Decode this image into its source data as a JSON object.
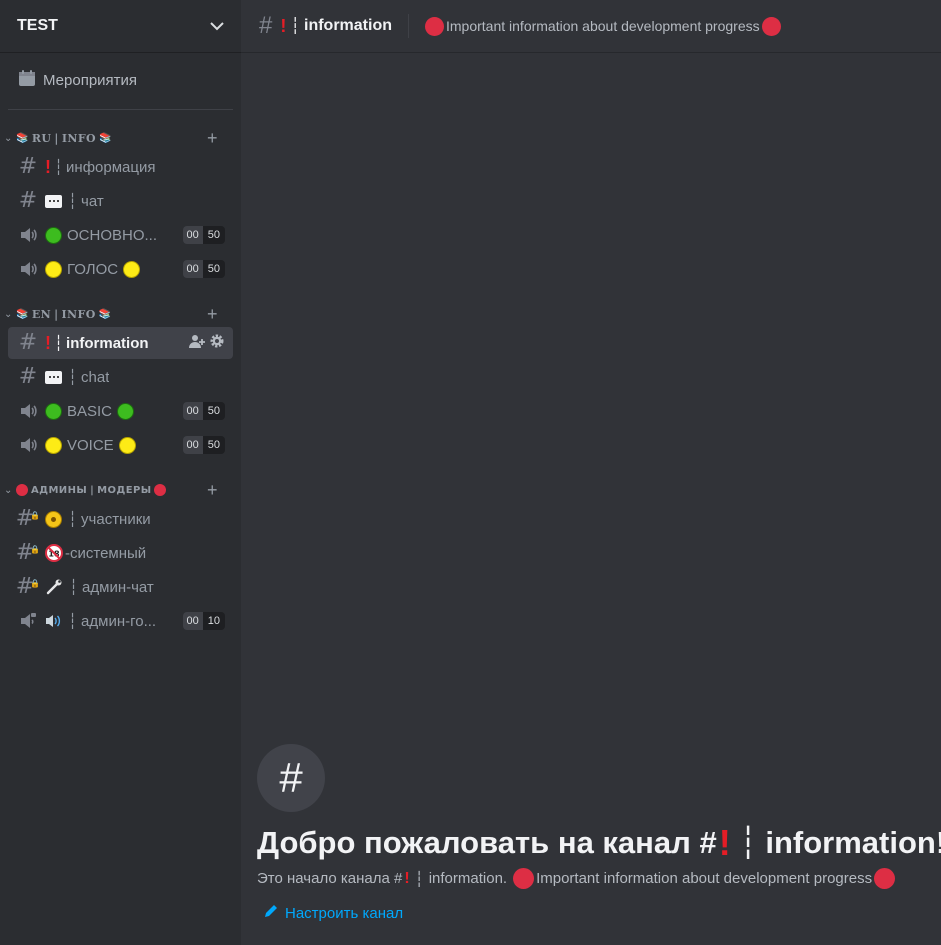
{
  "server": {
    "name": "TEST"
  },
  "events": {
    "label": "Мероприятия"
  },
  "categories": [
    {
      "label_pre": "RU",
      "label_post": "INFO",
      "sep": "|"
    },
    {
      "label_pre": "EN",
      "label_post": "INFO",
      "sep": "|"
    },
    {
      "label_pre": "АДМИНЫ",
      "label_post": "МОДЕРЫ",
      "sep": "|"
    }
  ],
  "channels": {
    "ru": [
      {
        "name": "информация",
        "sep": "┆"
      },
      {
        "name": "чат",
        "sep": "┆"
      },
      {
        "name": "ОСНОВНО...",
        "users": "00",
        "limit": "50"
      },
      {
        "name": "ГОЛОС",
        "users": "00",
        "limit": "50"
      }
    ],
    "en": [
      {
        "name": "information",
        "sep": "┆"
      },
      {
        "name": "chat",
        "sep": "┆"
      },
      {
        "name": "BASIC",
        "users": "00",
        "limit": "50"
      },
      {
        "name": "VOICE",
        "users": "00",
        "limit": "50"
      }
    ],
    "admin": [
      {
        "name": "участники",
        "sep": "┆"
      },
      {
        "name": "-системный"
      },
      {
        "name": "админ-чат",
        "sep": "┆"
      },
      {
        "name": "админ-го...",
        "sep": "┆",
        "users": "00",
        "limit": "10"
      }
    ]
  },
  "topbar": {
    "channel_sep": "┆",
    "channel_name": "information",
    "topic": "Important information about development progress"
  },
  "welcome": {
    "title_pre": "Добро пожаловать на канал #",
    "title_sep": "┆",
    "title_post": "information!",
    "sub_pre": "Это начало канала #",
    "sub_sep": "┆",
    "sub_name": "information.",
    "sub_topic": "Important information about development progress",
    "edit_label": "Настроить канал"
  },
  "colors": {
    "accent_link": "#00a8fc",
    "red": "#dd2e44",
    "green": "#3dbc1f",
    "yellow": "#fdeb16"
  }
}
